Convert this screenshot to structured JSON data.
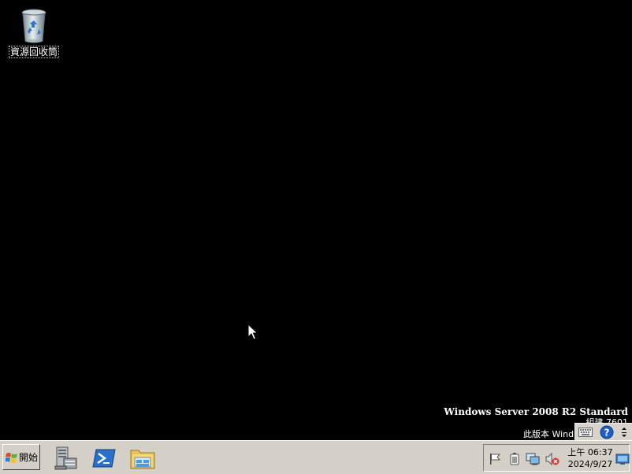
{
  "desktop": {
    "icons": [
      {
        "label": "資源回收筒",
        "icon": "recycle-bin-icon"
      }
    ]
  },
  "watermark": {
    "title": "Windows Server 2008 R2 Standard",
    "build": "組建 7601",
    "copy_notice": "此版本 Wind"
  },
  "language_bar": {
    "items": [
      "keyboard-icon",
      "help-icon",
      "options-icon"
    ]
  },
  "taskbar": {
    "start_label": "開始",
    "quick_launch": [
      {
        "icon": "server-manager-icon"
      },
      {
        "icon": "powershell-icon"
      },
      {
        "icon": "windows-explorer-icon"
      }
    ],
    "tray": {
      "icons": [
        "action-center-flag-icon",
        "power-icon",
        "network-icon",
        "volume-muted-icon"
      ],
      "clock": {
        "time": "上午 06:37",
        "date": "2024/9/27"
      }
    }
  },
  "colors": {
    "desktop_background": "#000000",
    "taskbar_background": "#d4d0c8"
  }
}
